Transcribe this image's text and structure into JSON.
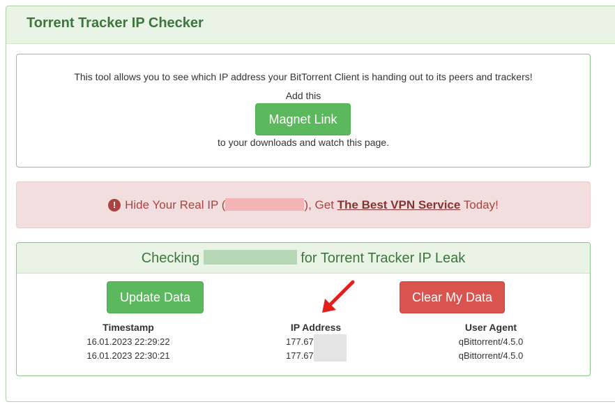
{
  "page": {
    "title": "Torrent Tracker IP Checker"
  },
  "info": {
    "description": "This tool allows you to see which IP address your BitTorrent Client is handing out to its peers and trackers!",
    "add_this": "Add this",
    "magnet_button": "Magnet Link",
    "after": "to your downloads and watch this page."
  },
  "alert": {
    "icon": "exclamation-circle-icon",
    "prefix": "Hide Your Real IP (",
    "middle": "), Get ",
    "link_text": "The Best VPN Service",
    "suffix": " Today!"
  },
  "checker": {
    "heading_prefix": "Checking",
    "heading_suffix": "for Torrent Tracker IP Leak",
    "update_button": "Update Data",
    "clear_button": "Clear My Data",
    "columns": {
      "timestamp": "Timestamp",
      "ip": "IP Address",
      "user_agent": "User Agent"
    },
    "rows": [
      {
        "timestamp": "16.01.2023 22:29:22",
        "ip": "177.67",
        "user_agent": "qBittorrent/4.5.0"
      },
      {
        "timestamp": "16.01.2023 22:30:21",
        "ip": "177.67",
        "user_agent": "qBittorrent/4.5.0"
      }
    ]
  },
  "colors": {
    "primary_green": "#5cb85c",
    "danger_red": "#d9534f",
    "heading_green": "#3c763d",
    "alert_red": "#a94442",
    "annotation_arrow": "#e0201b"
  }
}
